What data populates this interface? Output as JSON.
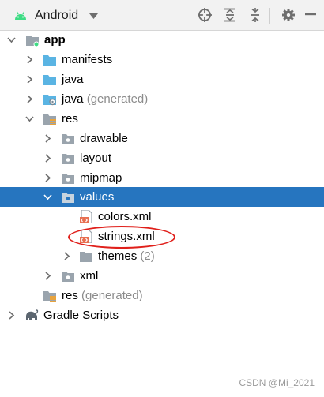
{
  "toolbar": {
    "view_label": "Android",
    "icons": [
      "android-icon",
      "dropdown-icon",
      "locate-icon",
      "expand-all-icon",
      "collapse-all-icon",
      "settings-icon",
      "hide-icon"
    ]
  },
  "tree": {
    "app": "app",
    "manifests": "manifests",
    "java": "java",
    "java_generated_name": "java",
    "java_generated_suffix": "(generated)",
    "res": "res",
    "drawable": "drawable",
    "layout": "layout",
    "mipmap": "mipmap",
    "values": "values",
    "colors": "colors.xml",
    "strings": "strings.xml",
    "themes_name": "themes",
    "themes_count": "(2)",
    "xml": "xml",
    "res_generated_name": "res",
    "res_generated_suffix": "(generated)",
    "gradle": "Gradle Scripts"
  },
  "selected_item": "values",
  "highlight_color": "#e0201b",
  "selection_color": "#2675bf",
  "watermark": "CSDN @Mi_2021"
}
